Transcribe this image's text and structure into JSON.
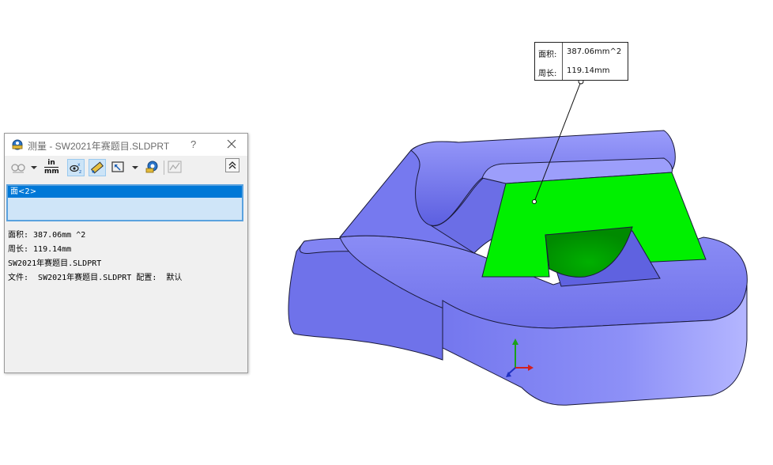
{
  "dialog": {
    "title": "测量 - SW2021年赛题目.SLDPRT",
    "help_label": "?",
    "toolbar": {
      "units_top": "in",
      "units_bottom": "mm"
    },
    "selection": {
      "items": [
        "面<2>"
      ]
    },
    "results": [
      "面积: 387.06mm ^2",
      "周长: 119.14mm",
      "SW2021年赛题目.SLDPRT",
      "文件:  SW2021年赛题目.SLDPRT 配置:  默认"
    ]
  },
  "callout": {
    "area_label": "面积:",
    "area_value": "387.06mm^2",
    "perimeter_label": "周长:",
    "perimeter_value": "119.14mm"
  },
  "colors": {
    "model_body": "#7a7df2",
    "selected_face": "#00ee00",
    "selection_highlight": "#0078d7"
  },
  "icons": [
    "measure-app-icon",
    "close-icon",
    "arc-circle-icon",
    "units-icon",
    "xyz-dimension-icon",
    "point-to-point-icon",
    "projection-icon",
    "history-icon",
    "sensor-icon",
    "collapse-icon",
    "triad-icon"
  ]
}
